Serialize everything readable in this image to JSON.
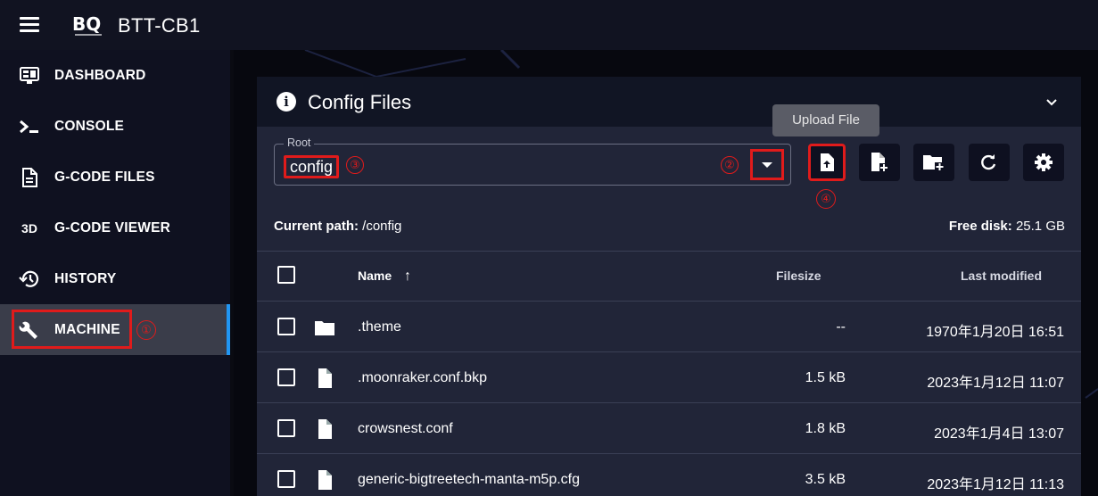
{
  "app": {
    "title": "BTT-CB1",
    "logo_text": "BQ"
  },
  "sidebar": {
    "items": [
      {
        "label": "DASHBOARD",
        "icon": "dashboard-icon"
      },
      {
        "label": "CONSOLE",
        "icon": "console-icon"
      },
      {
        "label": "G-CODE FILES",
        "icon": "file-document-icon"
      },
      {
        "label": "G-CODE VIEWER",
        "icon": "3d-icon",
        "icon_text": "3D"
      },
      {
        "label": "HISTORY",
        "icon": "history-icon"
      },
      {
        "label": "MACHINE",
        "icon": "wrench-icon",
        "active": true
      }
    ]
  },
  "card": {
    "title": "Config Files",
    "root_legend": "Root",
    "root_value": "config",
    "tooltip": "Upload File",
    "current_path_label": "Current path:",
    "current_path_value": "/config",
    "free_disk_label": "Free disk:",
    "free_disk_value": "25.1 GB",
    "columns": {
      "name": "Name",
      "sort_arrow": "↑",
      "filesize": "Filesize",
      "modified": "Last modified"
    },
    "files": [
      {
        "type": "folder",
        "name": ".theme",
        "size": "--",
        "modified": "1970年1月20日 16:51"
      },
      {
        "type": "file",
        "name": ".moonraker.conf.bkp",
        "size": "1.5 kB",
        "modified": "2023年1月12日 11:07"
      },
      {
        "type": "file",
        "name": "crowsnest.conf",
        "size": "1.8 kB",
        "modified": "2023年1月4日 13:07"
      },
      {
        "type": "file",
        "name": "generic-bigtreetech-manta-m5p.cfg",
        "size": "3.5 kB",
        "modified": "2023年1月12日 11:13"
      }
    ]
  },
  "annotations": {
    "one": "①",
    "two": "②",
    "three": "③",
    "four": "④"
  },
  "colors": {
    "accent": "#2196f3",
    "highlight": "#e01b1b",
    "card": "#212538",
    "sidebar": "#0f1120"
  }
}
